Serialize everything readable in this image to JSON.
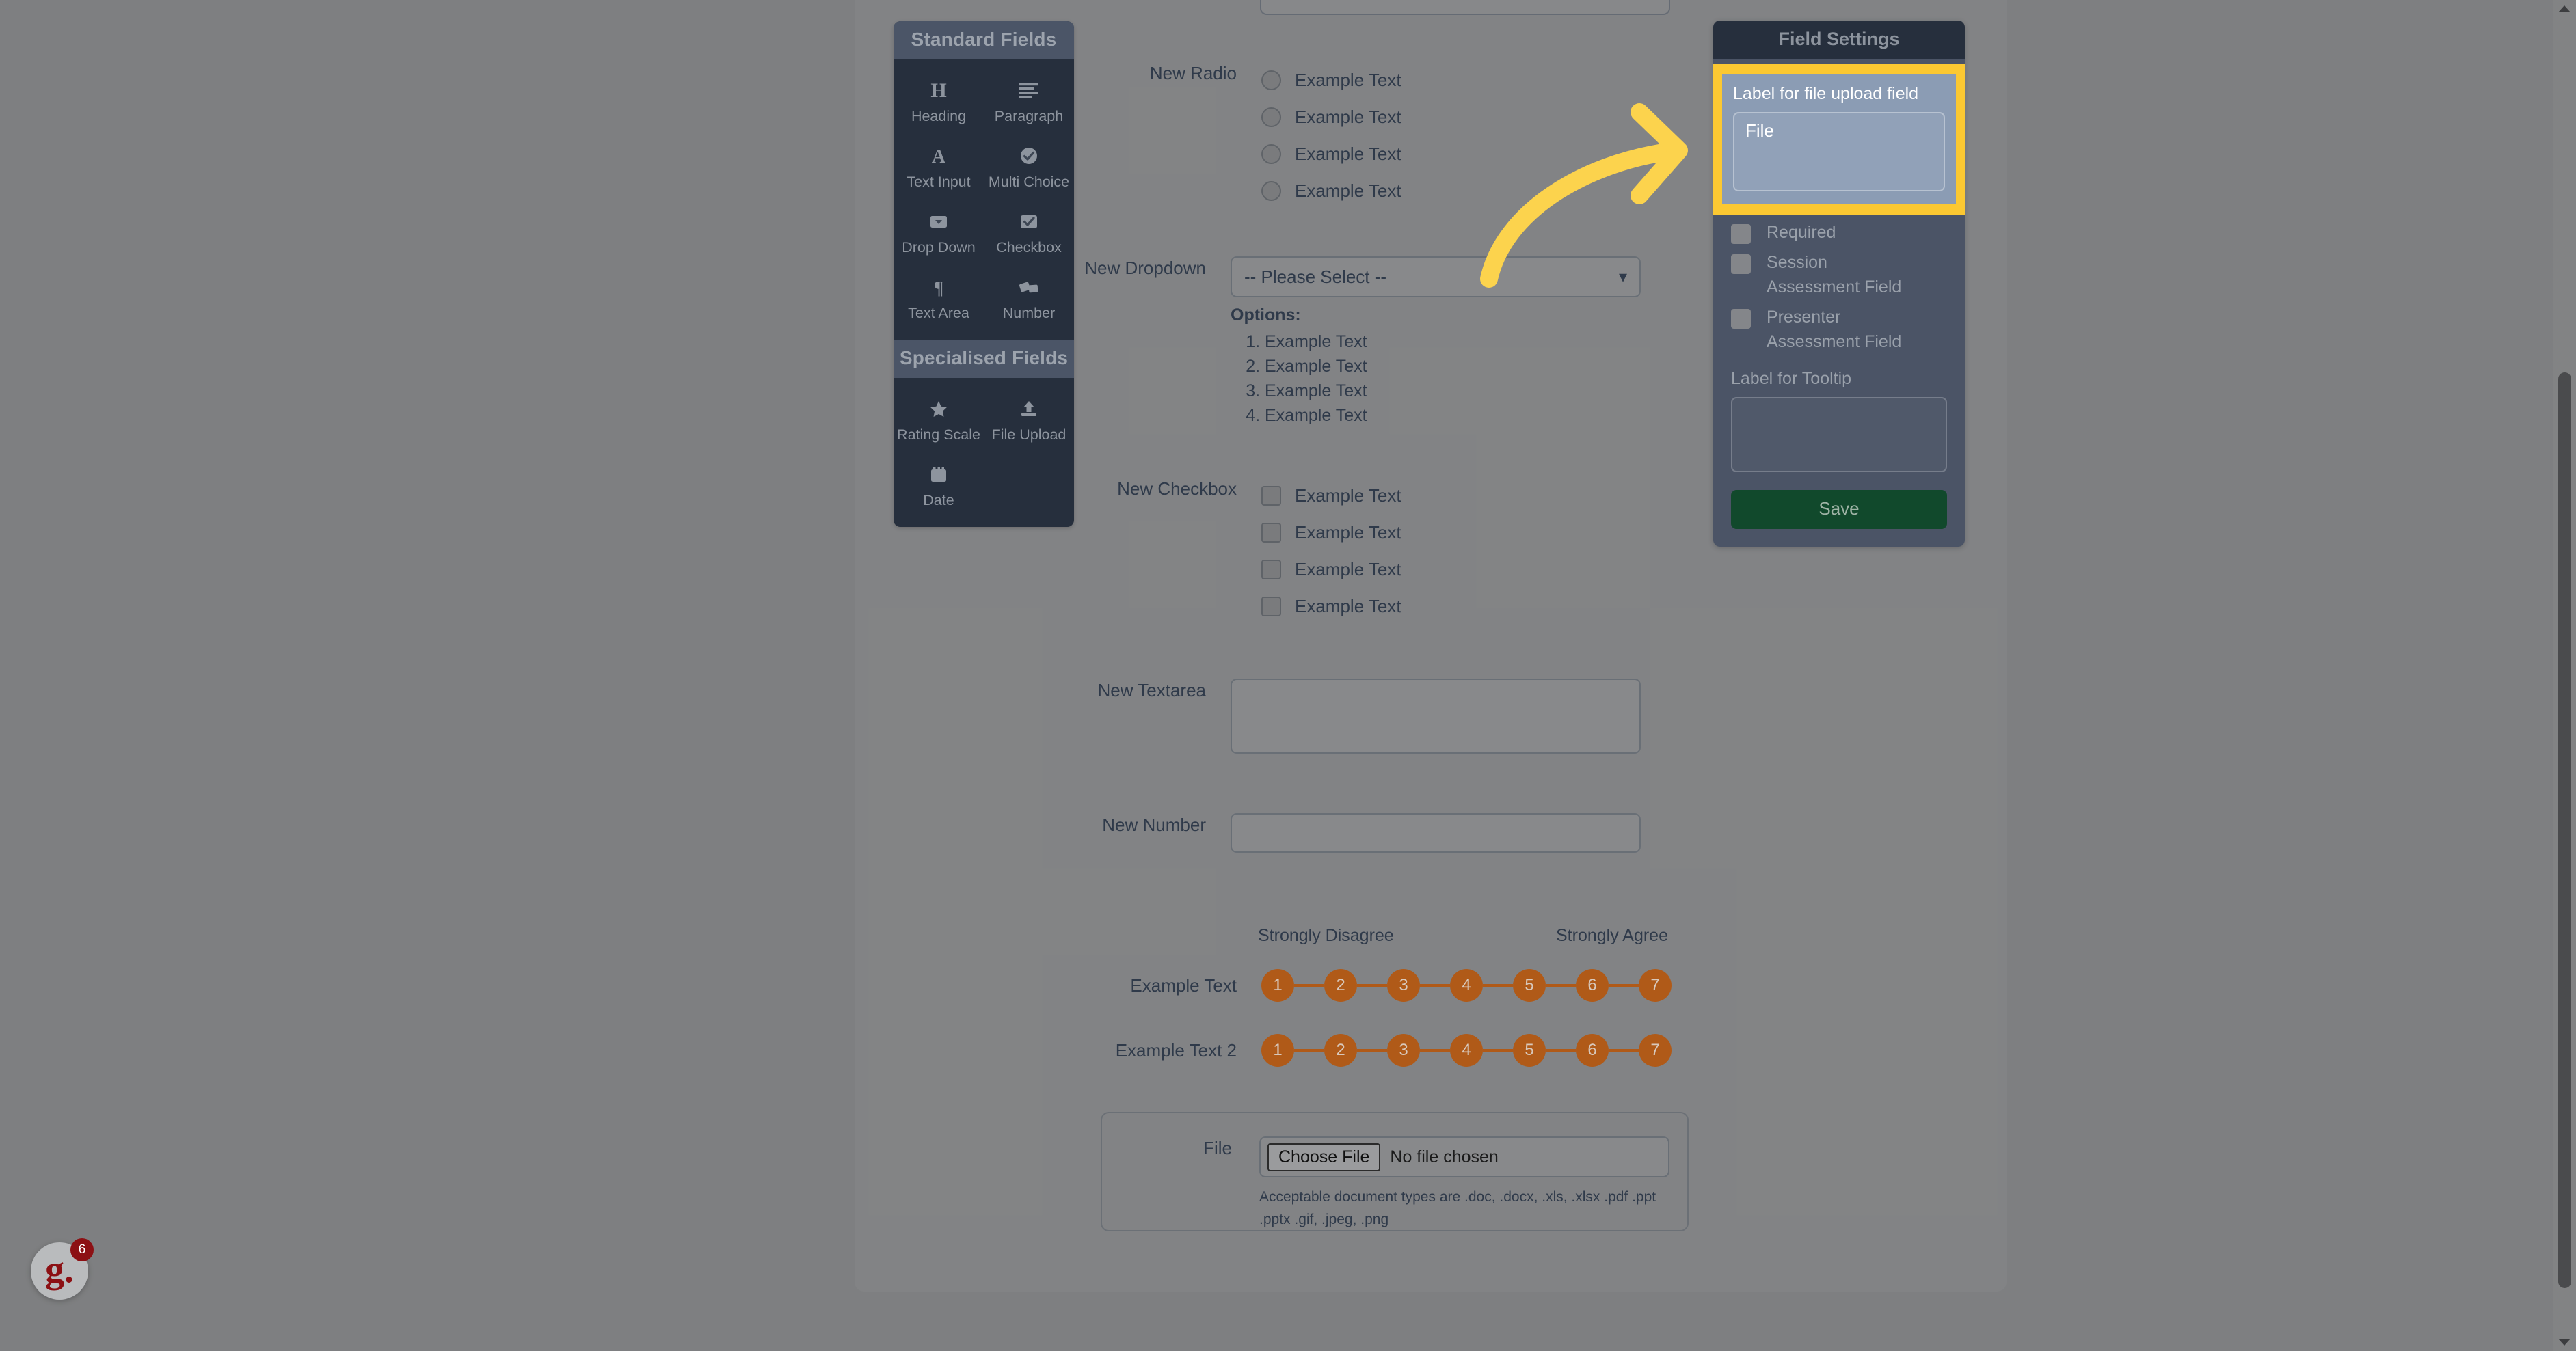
{
  "palette": {
    "sections": [
      {
        "title": "Standard Fields",
        "items": [
          {
            "label": "Heading",
            "icon": "heading-icon"
          },
          {
            "label": "Paragraph",
            "icon": "paragraph-icon"
          },
          {
            "label": "Text Input",
            "icon": "text-input-icon"
          },
          {
            "label": "Multi Choice",
            "icon": "multi-choice-icon"
          },
          {
            "label": "Drop Down",
            "icon": "drop-down-icon"
          },
          {
            "label": "Checkbox",
            "icon": "checkbox-icon"
          },
          {
            "label": "Text Area",
            "icon": "text-area-icon"
          },
          {
            "label": "Number",
            "icon": "number-icon"
          }
        ]
      },
      {
        "title": "Specialised Fields",
        "items": [
          {
            "label": "Rating Scale",
            "icon": "star-icon"
          },
          {
            "label": "File Upload",
            "icon": "upload-icon"
          },
          {
            "label": "Date",
            "icon": "calendar-icon"
          }
        ]
      }
    ]
  },
  "form": {
    "radio": {
      "label": "New Radio",
      "options": [
        "Example Text",
        "Example Text",
        "Example Text",
        "Example Text"
      ]
    },
    "dropdown": {
      "label": "New Dropdown",
      "selected": "-- Please Select --",
      "options_title": "Options:",
      "options": [
        "Example Text",
        "Example Text",
        "Example Text",
        "Example Text"
      ]
    },
    "checkbox": {
      "label": "New Checkbox",
      "options": [
        "Example Text",
        "Example Text",
        "Example Text",
        "Example Text"
      ]
    },
    "textarea": {
      "label": "New Textarea",
      "value": ""
    },
    "number": {
      "label": "New Number",
      "value": ""
    },
    "rating": {
      "anchor_left": "Strongly Disagree",
      "anchor_right": "Strongly Agree",
      "rows": [
        {
          "label": "Example Text",
          "points": [
            "1",
            "2",
            "3",
            "4",
            "5",
            "6",
            "7"
          ]
        },
        {
          "label": "Example Text 2",
          "points": [
            "1",
            "2",
            "3",
            "4",
            "5",
            "6",
            "7"
          ]
        }
      ]
    },
    "file": {
      "label": "File",
      "choose_button": "Choose File",
      "status": "No file chosen",
      "hint": "Acceptable document types are .doc, .docx, .xls, .xlsx .pdf .ppt .pptx .gif, .jpeg, .png"
    }
  },
  "settings": {
    "title": "Field Settings",
    "label_field_title": "Label for file upload field",
    "label_field_value": "File",
    "checkboxes": [
      "Required",
      "Session Assessment Field",
      "Presenter Assessment Field"
    ],
    "tooltip_label": "Label for Tooltip",
    "tooltip_value": "",
    "save_label": "Save"
  },
  "widget": {
    "logo_text": "g.",
    "badge_count": "6"
  },
  "colors": {
    "highlight": "#fbc832",
    "arrow": "#fcd34d",
    "save": "#11492c",
    "rating": "#b05a18"
  }
}
